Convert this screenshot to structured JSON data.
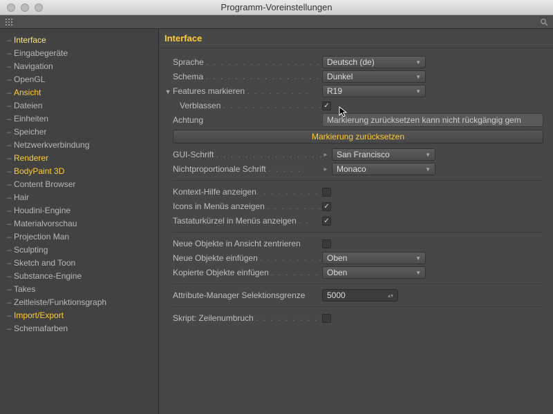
{
  "window": {
    "title": "Programm-Voreinstellungen"
  },
  "sidebar": {
    "items": [
      {
        "label": "Interface",
        "hl": true,
        "sel": true
      },
      {
        "label": "Eingabegeräte",
        "hl": false
      },
      {
        "label": "Navigation",
        "hl": false
      },
      {
        "label": "OpenGL",
        "hl": false
      },
      {
        "label": "Ansicht",
        "hl": true
      },
      {
        "label": "Dateien",
        "hl": false
      },
      {
        "label": "Einheiten",
        "hl": false
      },
      {
        "label": "Speicher",
        "hl": false
      },
      {
        "label": "Netzwerkverbindung",
        "hl": false
      },
      {
        "label": "Renderer",
        "hl": true
      },
      {
        "label": "BodyPaint 3D",
        "hl": true
      },
      {
        "label": "Content Browser",
        "hl": false
      },
      {
        "label": "Hair",
        "hl": false
      },
      {
        "label": "Houdini-Engine",
        "hl": false
      },
      {
        "label": "Materialvorschau",
        "hl": false
      },
      {
        "label": "Projection Man",
        "hl": false
      },
      {
        "label": "Sculpting",
        "hl": false
      },
      {
        "label": "Sketch and Toon",
        "hl": false
      },
      {
        "label": "Substance-Engine",
        "hl": false
      },
      {
        "label": "Takes",
        "hl": false
      },
      {
        "label": "Zeitleiste/Funktionsgraph",
        "hl": false
      },
      {
        "label": "Import/Export",
        "hl": true
      },
      {
        "label": "Schemafarben",
        "hl": false
      }
    ]
  },
  "panel": {
    "title": "Interface",
    "language": {
      "label": "Sprache",
      "value": "Deutsch (de)"
    },
    "scheme": {
      "label": "Schema",
      "value": "Dunkel"
    },
    "features": {
      "label": "Features markieren",
      "value": "R19"
    },
    "fade": {
      "label": "Verblassen",
      "checked": true
    },
    "warn": {
      "label": "Achtung",
      "text": "Markierung zurücksetzen kann nicht rückgängig gem"
    },
    "resetbtn": "Markierung zurücksetzen",
    "gui_font": {
      "label": "GUI-Schrift",
      "value": "San Francisco"
    },
    "mono_font": {
      "label": "Nichtproportionale Schrift",
      "value": "Monaco"
    },
    "context_help": {
      "label": "Kontext-Hilfe anzeigen",
      "checked": false
    },
    "icons_menus": {
      "label": "Icons in Menüs anzeigen",
      "checked": true
    },
    "shortcuts_menus": {
      "label": "Tastaturkürzel in Menüs anzeigen",
      "checked": true
    },
    "center_new": {
      "label": "Neue Objekte in Ansicht zentrieren",
      "checked": false
    },
    "insert_new": {
      "label": "Neue Objekte einfügen",
      "value": "Oben"
    },
    "insert_copy": {
      "label": "Kopierte Objekte einfügen",
      "value": "Oben"
    },
    "am_limit": {
      "label": "Attribute-Manager Selektionsgrenze",
      "value": "5000"
    },
    "script_wrap": {
      "label": "Skript: Zeilenumbruch",
      "checked": false
    }
  }
}
